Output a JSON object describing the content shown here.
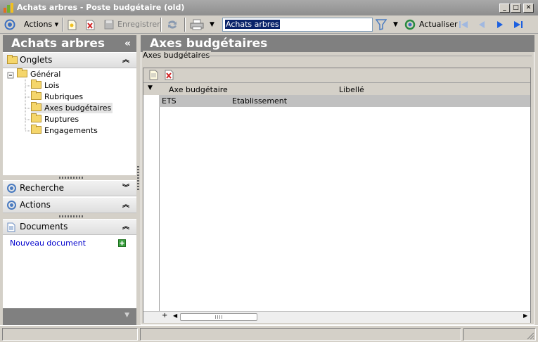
{
  "window": {
    "title": "Achats arbres - Poste budgétaire (old)"
  },
  "toolbar": {
    "actions_label": "Actions",
    "save_label": "Enregistrer",
    "search_value": "Achats arbres",
    "refresh_label": "Actualiser"
  },
  "left_panel": {
    "title": "Achats arbres",
    "onglets_label": "Onglets",
    "tree": {
      "root": "Général",
      "children": [
        "Lois",
        "Rubriques",
        "Axes budgétaires",
        "Ruptures",
        "Engagements"
      ],
      "selected": "Axes budgétaires"
    },
    "recherche_label": "Recherche",
    "actions_label": "Actions",
    "documents_label": "Documents",
    "new_document_label": "Nouveau document"
  },
  "main": {
    "title": "Axes budgétaires",
    "groupbox_label": "Axes budgétaires",
    "table": {
      "headers": [
        "Axe budgétaire",
        "Libellé"
      ],
      "rows": [
        {
          "axe": "ETS",
          "libelle": "Etablissement"
        }
      ]
    }
  },
  "colors": {
    "header_gray": "#808080",
    "selection": "#0a246a",
    "link": "#0000cc"
  }
}
